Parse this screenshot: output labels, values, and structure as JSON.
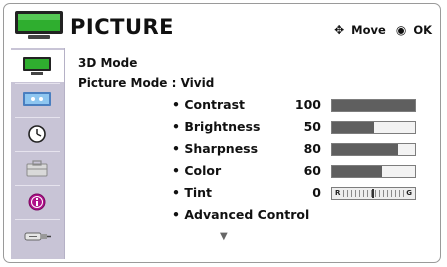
{
  "header": {
    "title": "PICTURE",
    "move_label": "Move",
    "ok_label": "OK",
    "move_icon": "move-arrows-icon",
    "ok_icon": "ok-circle-icon"
  },
  "sidebar": {
    "items": [
      {
        "icon": "picture-icon",
        "selected": true
      },
      {
        "icon": "audio-icon",
        "selected": false
      },
      {
        "icon": "time-icon",
        "selected": false
      },
      {
        "icon": "option-icon",
        "selected": false
      },
      {
        "icon": "info-icon",
        "selected": false
      },
      {
        "icon": "input-icon",
        "selected": false
      }
    ]
  },
  "main": {
    "mode_3d": "3D Mode",
    "picture_mode": "Picture Mode : Vivid",
    "settings": [
      {
        "name": "• Contrast",
        "value": "100",
        "level": 1.0
      },
      {
        "name": "• Brightness",
        "value": "50",
        "level": 0.5
      },
      {
        "name": "• Sharpness",
        "value": "80",
        "level": 0.8
      },
      {
        "name": "• Color",
        "value": "60",
        "level": 0.6
      },
      {
        "name": "• Tint",
        "value": "0",
        "left_label": "R",
        "right_label": "G"
      }
    ],
    "advanced": "• Advanced Control",
    "more_indicator": "▼"
  },
  "colors": {
    "sidebar_bg": "#c8c4d6",
    "bar_fill": "#5f5f5f",
    "screen_green": "#2fae2f"
  }
}
